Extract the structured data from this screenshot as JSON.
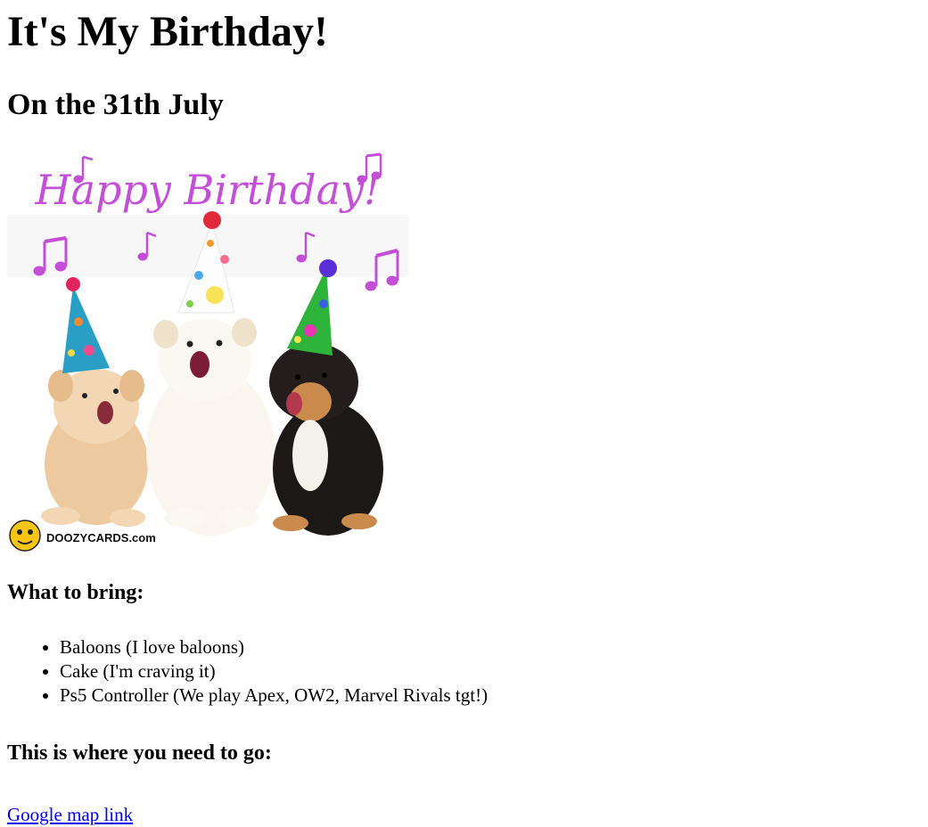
{
  "page": {
    "title": "It's My Birthday!",
    "subtitle": "On the 31th July"
  },
  "card_image": {
    "headline": "Happy Birthday!",
    "brand": "DOOZYCARDS.com",
    "logo_text": "DOOZY CARDS",
    "colors": {
      "headline": "#c24fd6",
      "notes": "#c24fd6"
    }
  },
  "bring": {
    "heading": "What to bring:",
    "items": [
      "Baloons (I love baloons)",
      "Cake (I'm craving it)",
      "Ps5 Controller (We play Apex, OW2, Marvel Rivals tgt!)"
    ]
  },
  "location": {
    "heading": "This is where you need to go:",
    "link_text": "Google map link"
  }
}
